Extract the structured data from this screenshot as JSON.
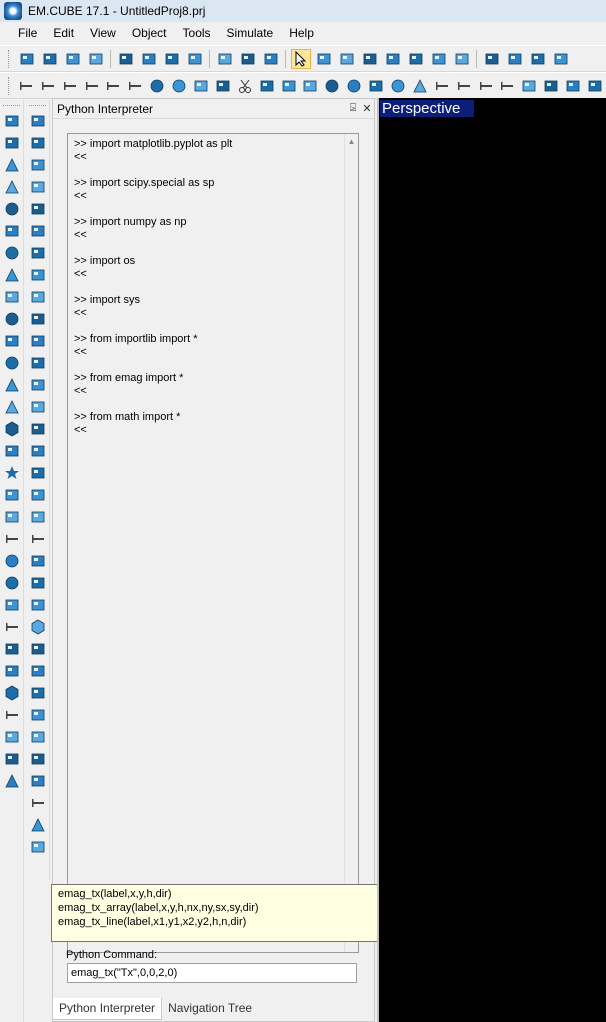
{
  "app": {
    "title": "EM.CUBE 17.1 - UntitledProj8.prj"
  },
  "menu": {
    "items": [
      "File",
      "Edit",
      "View",
      "Object",
      "Tools",
      "Simulate",
      "Help"
    ]
  },
  "panel": {
    "title": "Python Interpreter",
    "pin_glyph": "⍄",
    "close_glyph": "✕",
    "output": [
      {
        "cmd": ">> import matplotlib.pyplot as plt",
        "resp": "<<"
      },
      {
        "cmd": ">> import scipy.special as sp",
        "resp": "<<"
      },
      {
        "cmd": ">> import numpy as np",
        "resp": "<<"
      },
      {
        "cmd": ">> import os",
        "resp": "<<"
      },
      {
        "cmd": ">> import sys",
        "resp": "<<"
      },
      {
        "cmd": ">> from importlib import *",
        "resp": "<<"
      },
      {
        "cmd": ">> from emag import *",
        "resp": "<<"
      },
      {
        "cmd": ">> from math import *",
        "resp": "<<"
      }
    ],
    "tooltip_lines": [
      "emag_tx(label,x,y,h,dir)",
      "emag_tx_array(label,x,y,h,nx,ny,sx,sy,dir)",
      "emag_tx_line(label,x1,y1,x2,y2,h,n,dir)"
    ],
    "command_label": "Python Command:",
    "command_value": "emag_tx(\"Tx\",0,0,2,0)"
  },
  "bottom_tabs": [
    "Python Interpreter",
    "Navigation Tree"
  ],
  "viewport": {
    "label": "Perspective"
  },
  "colors": {
    "accent": "#2a7fc4",
    "viewport_bg": "#000000",
    "view_label_bg": "#0a1e7a",
    "tooltip_bg": "#ffffe1"
  },
  "toolbar1_icons": [
    "new-icon",
    "open-icon",
    "save-icon",
    "print-icon",
    "cut-icon",
    "copy-icon",
    "paste-icon",
    "delete-icon",
    "undo-icon",
    "redo-icon",
    "monitor-icon",
    "select-arrow-icon",
    "pan-hand-icon",
    "rotate-icon",
    "zoom-icon",
    "zoom-fit-icon",
    "zoom-window-icon",
    "zoom-extents-icon",
    "refresh-icon",
    "grid-icon",
    "solid-icon",
    "view-3d-icon",
    "view-top-icon"
  ],
  "toolbar2_icons": [
    "ruler-1-icon",
    "ruler-2-icon",
    "ruler-3-icon",
    "ruler-4-icon",
    "ruler-5-icon",
    "ruler-6-icon",
    "circle-icon",
    "circle-2-icon",
    "box-2-icon",
    "box-3-icon",
    "scissors-icon",
    "array-icon",
    "link-icon",
    "arc-icon",
    "stop-icon",
    "pie-icon",
    "shield-icon",
    "ellipse-icon",
    "triangle-icon",
    "vertical-bar-icon",
    "bars-icon",
    "bars-2-icon",
    "dash-icon",
    "square-icon",
    "grid-2-icon",
    "cube-icon",
    "layout-icon"
  ],
  "left_tools_1": [
    "cube-icon",
    "cylinder-icon",
    "cone-icon",
    "pyramid-icon",
    "sphere-icon",
    "ellipsoid-icon",
    "torus-icon",
    "wedge-icon",
    "rect-icon",
    "circle-icon",
    "funnel-icon",
    "ellipse-flat-icon",
    "triangle-flat-icon",
    "pyramid-2-icon",
    "hexagon-icon",
    "spiral-icon",
    "star-icon",
    "heart-icon",
    "helix-icon",
    "line-icon",
    "circle-outline-icon",
    "oval-outline-icon",
    "u-curve-icon",
    "l-line-icon",
    "spiral-2-icon",
    "coil-icon",
    "polygon-icon",
    "polyline-icon",
    "chart-icon",
    "point-icon",
    "antenna-icon"
  ],
  "left_tools_2": [
    "move-icon",
    "rotate-icon",
    "scale-icon",
    "link-icon",
    "mirror-icon",
    "select-box-icon",
    "group-icon",
    "stack-icon",
    "array-icon",
    "subtract-icon",
    "light-icon",
    "box-shape-icon",
    "pen-icon",
    "extrude-icon",
    "revolve-icon",
    "loft-icon",
    "sweep-icon",
    "twist-icon",
    "crescent-icon",
    "bar-icon",
    "shell-icon",
    "fillet-icon",
    "fish-icon",
    "polyhedron-icon",
    "cube-3d-icon",
    "pointset-icon",
    "curve-icon",
    "flower-icon",
    "arrow-up-icon",
    "dots-icon",
    "wave-icon",
    "measure-icon",
    "angle-icon",
    "scale-2-icon"
  ]
}
